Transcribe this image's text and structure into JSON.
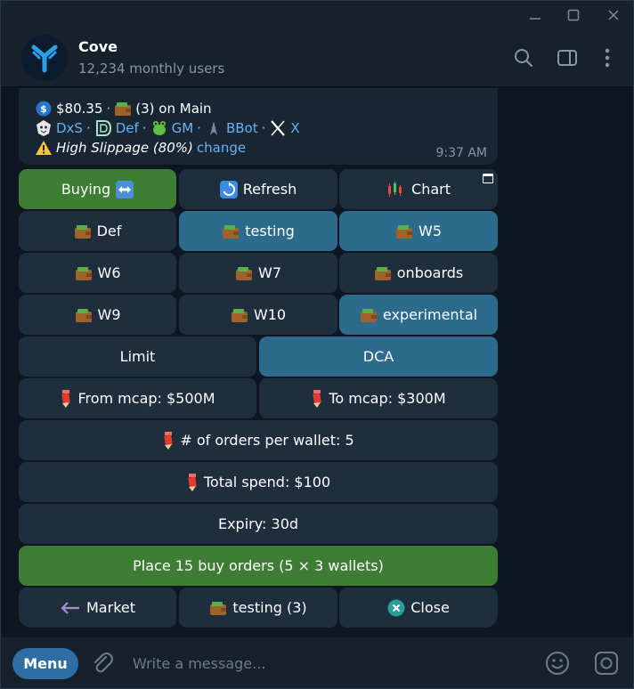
{
  "bot": {
    "name": "Cove",
    "subtitle": "12,234 monthly users"
  },
  "message": {
    "balance": "$80.35",
    "wallet_count": "(3) on Main",
    "links": [
      {
        "label": "DxS",
        "icon": "dxs-icon"
      },
      {
        "label": "Def",
        "icon": "def-icon"
      },
      {
        "label": "GM",
        "icon": "gm-frog-icon"
      },
      {
        "label": "BBot",
        "icon": "bbot-icon"
      },
      {
        "label": "X",
        "icon": "x-logo-icon"
      }
    ],
    "warning": "High Slippage (80%)",
    "warning_action": "change",
    "time": "9:37 AM"
  },
  "keyboard": {
    "mode_buying": "Buying",
    "refresh": "Refresh",
    "chart": "Chart",
    "wallets": [
      "Def",
      "testing",
      "W5",
      "W6",
      "W7",
      "onboards",
      "W9",
      "W10",
      "experimental"
    ],
    "selected_wallets": [
      "testing",
      "W5",
      "experimental"
    ],
    "order_types": [
      "Limit",
      "DCA"
    ],
    "selected_order_type": "DCA",
    "from_mcap": "From mcap: $500M",
    "to_mcap": "To mcap: $300M",
    "orders_per_wallet": "# of orders per wallet: 5",
    "total_spend": "Total spend: $100",
    "expiry": "Expiry: 30d",
    "place_orders": "Place 15 buy orders (5 × 3 wallets)",
    "back_market": "Market",
    "wallet_summary": "testing (3)",
    "close": "Close"
  },
  "composer": {
    "menu": "Menu",
    "placeholder": "Write a message..."
  },
  "colors": {
    "accent_green": "#3d7d34",
    "selected_blue": "#2c6b8c",
    "link_blue": "#6ab3f3",
    "menu_blue": "#2f6ea5"
  }
}
